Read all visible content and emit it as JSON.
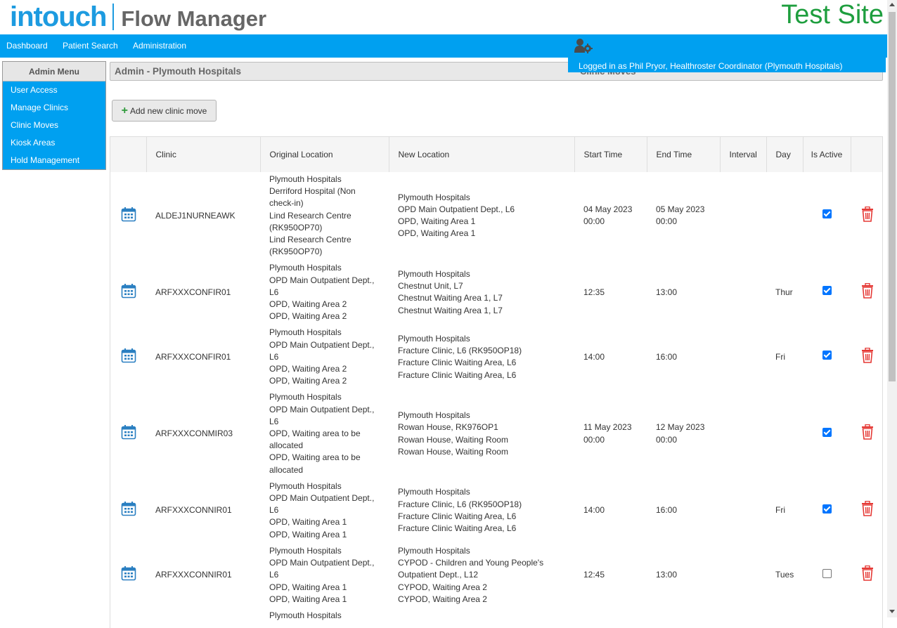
{
  "header": {
    "logo_intouch": "intouch",
    "logo_product": "Flow Manager",
    "site_label": "Test Site"
  },
  "nav": {
    "items": [
      "Dashboard",
      "Patient Search",
      "Administration"
    ]
  },
  "user": {
    "logged_in_text": "Logged in as Phil Pryor, Healthroster Coordinator (Plymouth Hospitals)"
  },
  "admin_menu": {
    "title": "Admin Menu",
    "items": [
      "User Access",
      "Manage Clinics",
      "Clinic Moves",
      "Kiosk Areas",
      "Hold Management"
    ]
  },
  "page": {
    "title": "Admin - Plymouth Hospitals",
    "section_behind": "Clinic Moves",
    "add_button": "Add new clinic move"
  },
  "table": {
    "headers": {
      "clinic": "Clinic",
      "original": "Original Location",
      "new": "New Location",
      "start": "Start Time",
      "end": "End Time",
      "interval": "Interval",
      "day": "Day",
      "active": "Is Active"
    },
    "rows": [
      {
        "clinic": "ALDEJ1NURNEAWK",
        "original": [
          "Plymouth Hospitals",
          "Derriford Hospital (Non check-in)",
          "Lind Research Centre (RK950OP70)",
          "Lind Research Centre (RK950OP70)"
        ],
        "new": [
          "Plymouth Hospitals",
          "OPD Main Outpatient Dept., L6",
          "OPD, Waiting Area 1",
          "OPD, Waiting Area 1"
        ],
        "start": [
          "04 May 2023",
          "00:00"
        ],
        "end": [
          "05 May 2023",
          "00:00"
        ],
        "interval": "",
        "day": "",
        "active": true
      },
      {
        "clinic": "ARFXXXCONFIR01",
        "original": [
          "Plymouth Hospitals",
          "OPD Main Outpatient Dept., L6",
          "OPD, Waiting Area 2",
          "OPD, Waiting Area 2"
        ],
        "new": [
          "Plymouth Hospitals",
          "Chestnut Unit, L7",
          "Chestnut Waiting Area 1, L7",
          "Chestnut Waiting Area 1, L7"
        ],
        "start": [
          "12:35"
        ],
        "end": [
          "13:00"
        ],
        "interval": "",
        "day": "Thur",
        "active": true
      },
      {
        "clinic": "ARFXXXCONFIR01",
        "original": [
          "Plymouth Hospitals",
          "OPD Main Outpatient Dept., L6",
          "OPD, Waiting Area 2",
          "OPD, Waiting Area 2"
        ],
        "new": [
          "Plymouth Hospitals",
          "Fracture Clinic, L6 (RK950OP18)",
          "Fracture Clinic Waiting Area, L6",
          "Fracture Clinic Waiting Area, L6"
        ],
        "start": [
          "14:00"
        ],
        "end": [
          "16:00"
        ],
        "interval": "",
        "day": "Fri",
        "active": true
      },
      {
        "clinic": "ARFXXXCONMIR03",
        "original": [
          "Plymouth Hospitals",
          "OPD Main Outpatient Dept., L6",
          "OPD, Waiting area to be allocated",
          "OPD, Waiting area to be allocated"
        ],
        "new": [
          "Plymouth Hospitals",
          "Rowan House, RK976OP1",
          "Rowan House, Waiting Room",
          "Rowan House, Waiting Room"
        ],
        "start": [
          "11 May 2023",
          "00:00"
        ],
        "end": [
          "12 May 2023",
          "00:00"
        ],
        "interval": "",
        "day": "",
        "active": true
      },
      {
        "clinic": "ARFXXXCONNIR01",
        "original": [
          "Plymouth Hospitals",
          "OPD Main Outpatient Dept., L6",
          "OPD, Waiting Area 1",
          "OPD, Waiting Area 1"
        ],
        "new": [
          "Plymouth Hospitals",
          "Fracture Clinic, L6 (RK950OP18)",
          "Fracture Clinic Waiting Area, L6",
          "Fracture Clinic Waiting Area, L6"
        ],
        "start": [
          "14:00"
        ],
        "end": [
          "16:00"
        ],
        "interval": "",
        "day": "Fri",
        "active": true
      },
      {
        "clinic": "ARFXXXCONNIR01",
        "original": [
          "Plymouth Hospitals",
          "OPD Main Outpatient Dept., L6",
          "OPD, Waiting Area 1",
          "OPD, Waiting Area 1"
        ],
        "new": [
          "Plymouth Hospitals",
          "CYPOD - Children and Young People's Outpatient Dept., L12",
          "CYPOD, Waiting Area 2",
          "CYPOD, Waiting Area 2"
        ],
        "start": [
          "12:45"
        ],
        "end": [
          "13:00"
        ],
        "interval": "",
        "day": "Tues",
        "active": false
      },
      {
        "clinic": "",
        "original": [
          "Plymouth Hospitals"
        ],
        "new": [],
        "start": [],
        "end": [],
        "interval": "",
        "day": "",
        "active": null
      }
    ]
  },
  "colors": {
    "brand_blue": "#00a0f0",
    "logo_blue": "#1d9be0",
    "test_site_green": "#1e9e3e",
    "delete_red": "#e53935",
    "calendar_blue": "#2a7fc1"
  },
  "icons": {
    "user_settings": "user-gear-icon",
    "calendar": "calendar-icon",
    "delete": "trash-icon",
    "add": "plus-icon"
  }
}
